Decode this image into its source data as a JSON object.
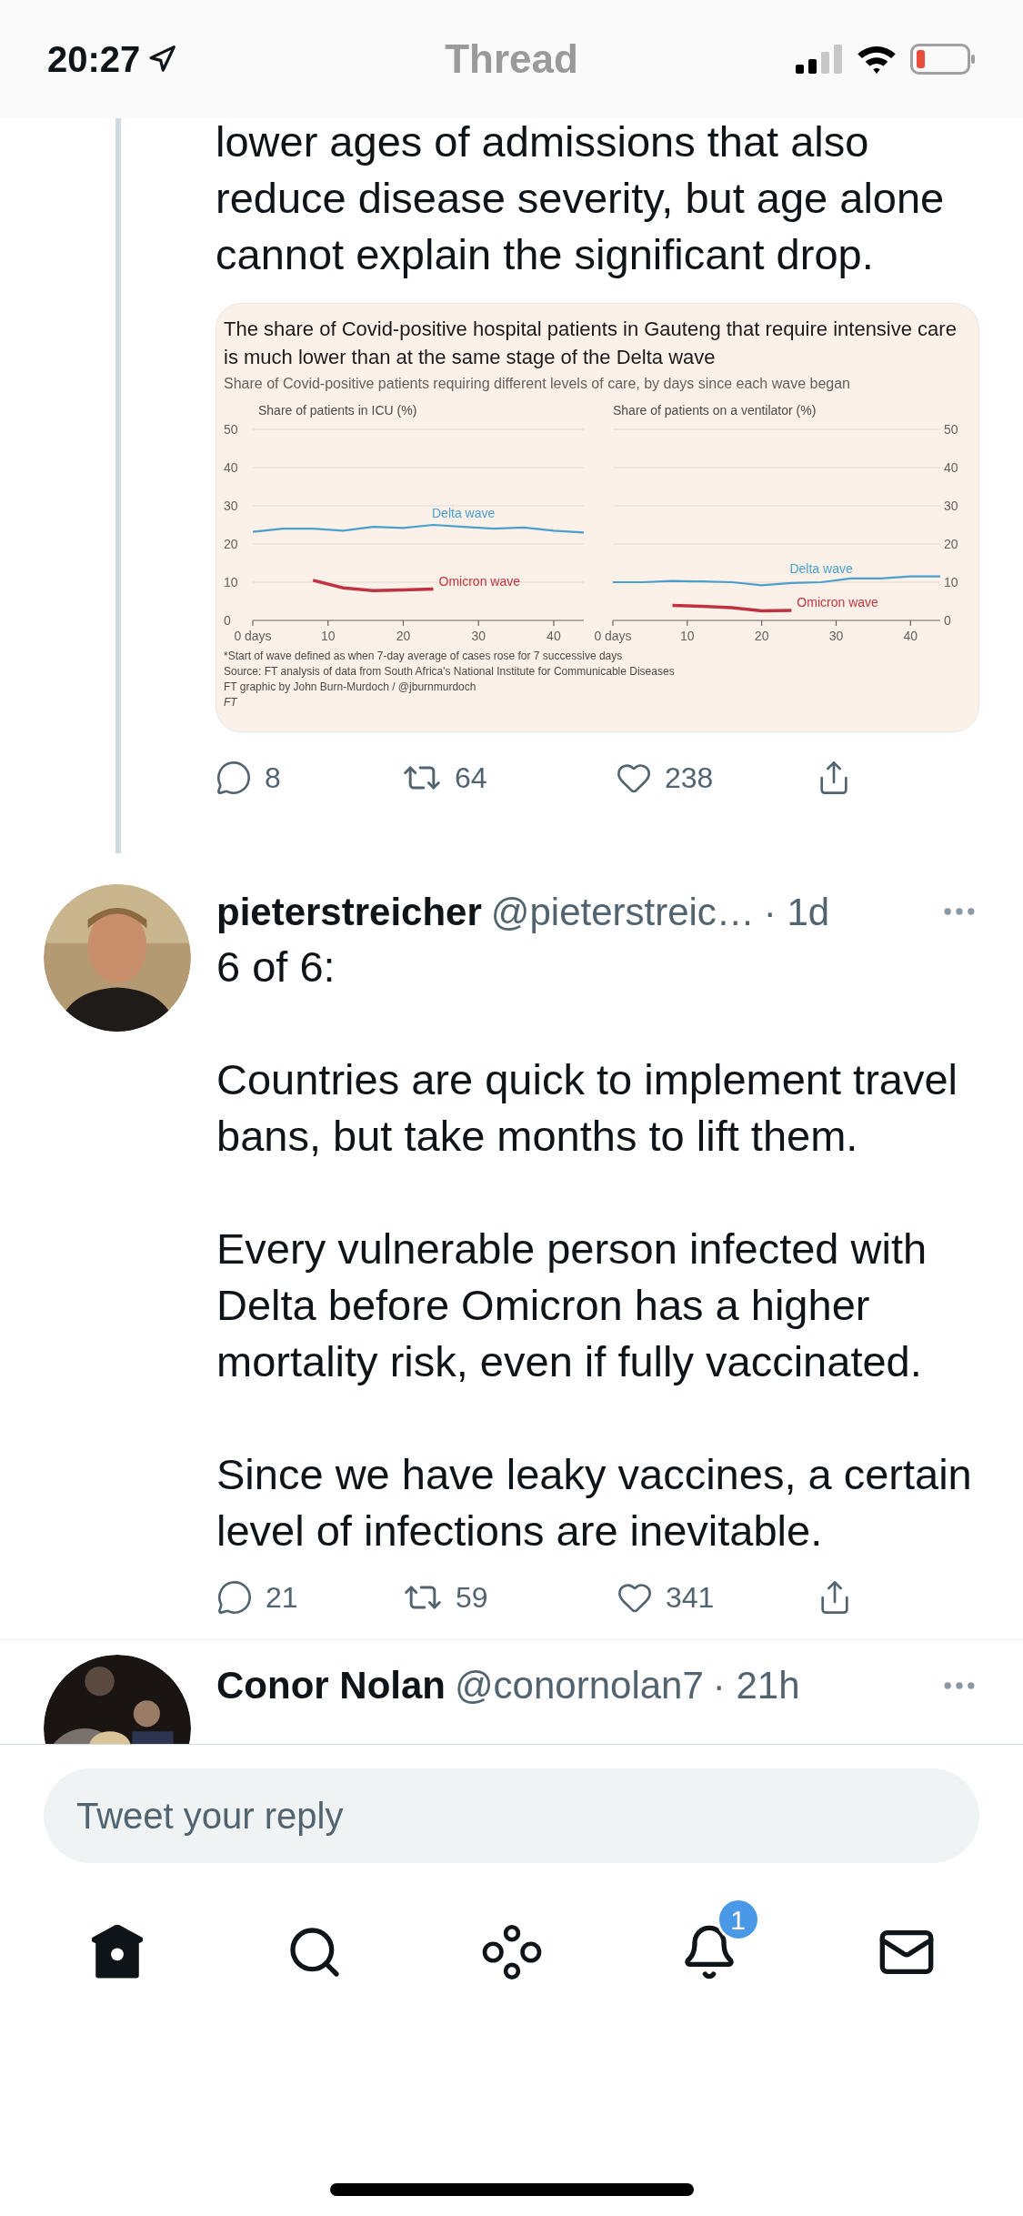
{
  "status_bar": {
    "time": "20:27"
  },
  "header": {
    "title": "Thread"
  },
  "tweets": [
    {
      "text": "lower ages of admissions that also reduce disease severity, but age alone cannot explain the significant drop.",
      "image": {
        "title": "The share of Covid-positive hospital patients in Gauteng that require intensive care is much lower than at the same stage of the Delta wave",
        "subtitle": "Share of Covid-positive patients requiring different levels of care, by days since each wave began",
        "notes": [
          "*Start of wave defined as when 7-day average of cases rose for 7 successive days",
          "Source: FT analysis of data from South Africa's National Institute for Communicable Diseases",
          "FT graphic by John Burn-Murdoch / @jburnmurdoch",
          "FT"
        ],
        "charts": [
          {
            "chart_data": {
              "type": "line",
              "title": "Share of patients in ICU (%)",
              "x": [
                0,
                4,
                8,
                12,
                16,
                20,
                24,
                28,
                32,
                36,
                40,
                44
              ],
              "xlim": [
                0,
                44
              ],
              "ylim": [
                0,
                50
              ],
              "grid": true,
              "xticks": [
                {
                  "value": 0,
                  "label": "0 days"
                },
                10,
                20,
                30,
                40
              ],
              "yticks": [
                0,
                10,
                20,
                30,
                40,
                50
              ],
              "series": [
                {
                  "name": "Delta wave",
                  "color": "#4a9fcf",
                  "values": [
                    23.2,
                    24,
                    24,
                    23.5,
                    24.5,
                    24.2,
                    25,
                    24.5,
                    24,
                    24.3,
                    23.5,
                    23
                  ]
                },
                {
                  "name": "Omicron wave",
                  "color": "#c0323f",
                  "values": [
                    null,
                    null,
                    10.5,
                    8.5,
                    7.8,
                    8,
                    8.2,
                    null,
                    null,
                    null,
                    null,
                    null
                  ]
                }
              ]
            }
          },
          {
            "chart_data": {
              "type": "line",
              "title": "Share of patients on a ventilator (%)",
              "x": [
                0,
                4,
                8,
                12,
                16,
                20,
                24,
                28,
                32,
                36,
                40,
                44
              ],
              "xlim": [
                0,
                44
              ],
              "ylim": [
                0,
                50
              ],
              "grid": true,
              "xticks": [
                {
                  "value": 0,
                  "label": "0 days"
                },
                10,
                20,
                30,
                40
              ],
              "yticks": [
                0,
                10,
                20,
                30,
                40,
                50
              ],
              "series": [
                {
                  "name": "Delta wave",
                  "color": "#4a9fcf",
                  "values": [
                    10,
                    10,
                    10.3,
                    10.2,
                    10,
                    9.2,
                    9.8,
                    10,
                    11,
                    11,
                    11.5,
                    11.5
                  ]
                },
                {
                  "name": "Omicron wave",
                  "color": "#c0323f",
                  "values": [
                    null,
                    null,
                    3.9,
                    3.7,
                    3.3,
                    2.5,
                    2.6,
                    null,
                    null,
                    null,
                    null,
                    null
                  ]
                }
              ]
            }
          }
        ]
      },
      "stats": {
        "replies": "8",
        "retweets": "64",
        "likes": "238"
      }
    },
    {
      "name": "pieterstreicher",
      "handle": "@pieterstreic…",
      "time": "· 1d",
      "paragraphs": [
        "6 of 6:",
        "Countries are quick to implement travel bans, but take months to lift them.",
        "Every vulnerable person infected with Delta before Omicron has a higher mortality risk, even if fully vaccinated.",
        "Since we have leaky vaccines, a certain level of infections are inevitable."
      ],
      "stats": {
        "replies": "21",
        "retweets": "59",
        "likes": "341"
      }
    },
    {
      "name": "Conor Nolan",
      "handle": "@conornolan7",
      "time": "· 21h"
    }
  ],
  "reply": {
    "placeholder": "Tweet your reply"
  },
  "nav": [
    {
      "kind": "home",
      "selected": true
    },
    {
      "kind": "search",
      "selected": false
    },
    {
      "kind": "spaces",
      "selected": false
    },
    {
      "kind": "notifications",
      "selected": false,
      "badge": "1"
    },
    {
      "kind": "messages",
      "selected": false
    }
  ]
}
